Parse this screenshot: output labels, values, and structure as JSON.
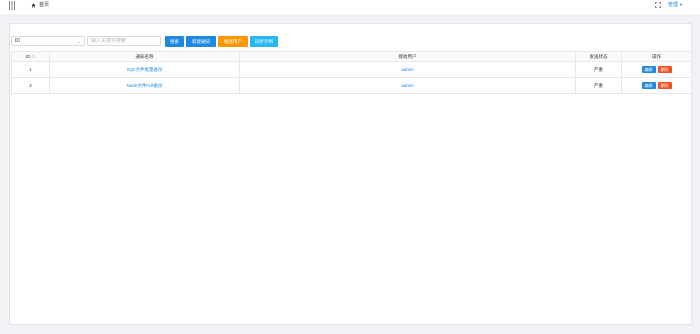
{
  "header": {
    "grid_icon": "grid-menu-icon",
    "home_icon": "home-icon",
    "home_label": "首页",
    "fullscreen_icon": "fullscreen-icon",
    "user_label": "管理",
    "user_caret": "▼"
  },
  "toolbar": {
    "select_value": "ID",
    "select_caret": "⌄",
    "search_placeholder": "输入关键字搜索",
    "search_button": "搜索",
    "add_button": "新建通知",
    "tool_button": "推送用户",
    "sync_button": "同步示例"
  },
  "table": {
    "headers": {
      "id": "ID",
      "id_sort": "⇅",
      "name": "通知名称",
      "user": "接收用户",
      "status": "发送状态",
      "ops": "操作"
    },
    "rows": [
      {
        "id": "1",
        "name": "SQL文件批量备份",
        "user": "admin",
        "status": "严重",
        "edit": "编辑",
        "delete": "删除"
      },
      {
        "id": "2",
        "name": "Node文件Full备份",
        "user": "admin",
        "status": "严重",
        "edit": "编辑",
        "delete": "删除"
      }
    ]
  },
  "colors": {
    "primary": "#1e88e5",
    "warning": "#ff9800",
    "info": "#29b6f6",
    "danger": "#f4511e"
  }
}
